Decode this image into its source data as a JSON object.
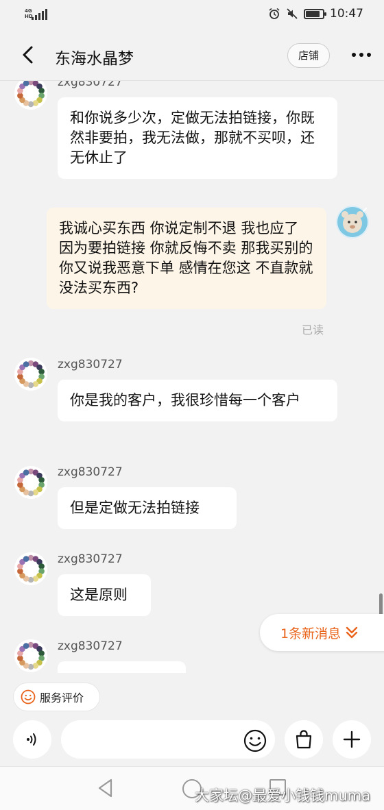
{
  "status_bar": {
    "network": "4G",
    "time": "10:47",
    "battery_level": 0.85
  },
  "header": {
    "title": "东海水晶梦",
    "shop_label": "店铺"
  },
  "messages": [
    {
      "sender": "zxg830727",
      "text": "和你说多少次，定做无法拍链接，你既然非要拍，我无法做，那就不买呗，还无休止了"
    },
    {
      "sender": "me",
      "text": "我诚心买东西 你说定制不退 我也应了 因为要拍链接 你就反悔不卖 那我买别的 你又说我恶意下单 感情在您这 不直款就没法买东西?",
      "status": "已读"
    },
    {
      "sender": "zxg830727",
      "text": "你是我的客户，我很珍惜每一个客户"
    },
    {
      "sender": "zxg830727",
      "text": "但是定做无法拍链接"
    },
    {
      "sender": "zxg830727",
      "text": "这是原则"
    },
    {
      "sender": "zxg830727",
      "text": ""
    }
  ],
  "new_message_label": "1条新消息",
  "bottom": {
    "evaluate_label": "服务评价",
    "input_placeholder": ""
  },
  "watermark": "大家坛@最爱小钱钱muma",
  "colors": {
    "accent": "#e9631a",
    "my_bubble": "#fdf5e8",
    "other_bubble": "#ffffff",
    "background": "#f2f2f2"
  }
}
